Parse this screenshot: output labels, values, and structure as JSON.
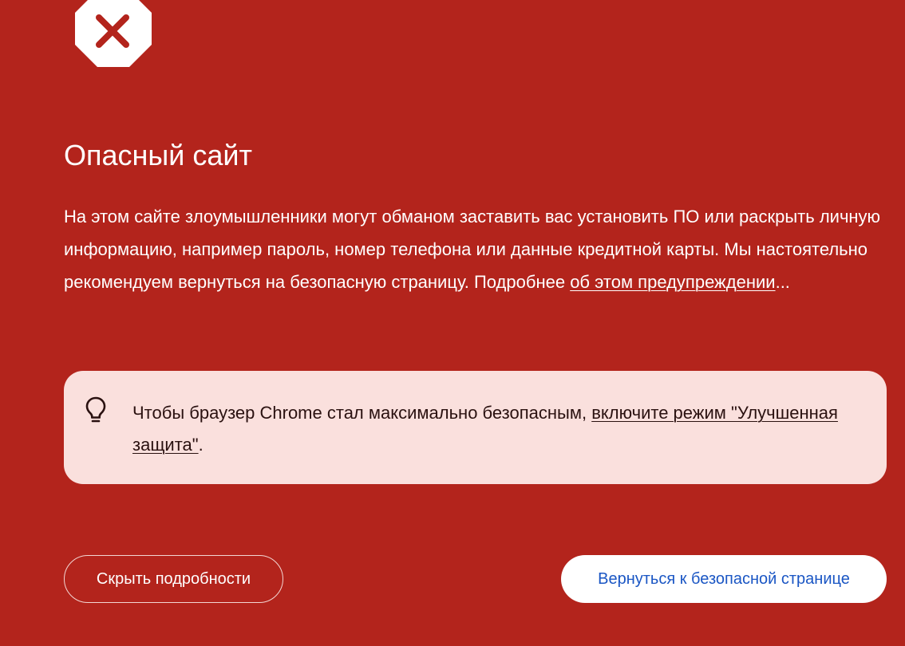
{
  "theme": {
    "background": "#b3241c",
    "tip_background": "#fae0dd",
    "back_button_text": "#1a56c4",
    "icon_x_color": "#b3241c"
  },
  "header": {
    "icon": "stop-octagon-x-icon",
    "title": "Опасный сайт"
  },
  "description": {
    "text": "На этом сайте злоумышленники могут обманом заставить вас установить ПО или раскрыть личную информацию, например пароль, номер телефона или данные кредитной карты. Мы настоятельно рекомендуем вернуться на безопасную страницу. Подробнее ",
    "link_label": "об этом предупреждении",
    "suffix": "..."
  },
  "tip": {
    "icon": "lightbulb-icon",
    "text": "Чтобы браузер Chrome стал максимально безопасным, ",
    "link_label": "включите режим \"Улучшенная защита\"",
    "suffix": "."
  },
  "buttons": {
    "details_label": "Скрыть подробности",
    "back_label": "Вернуться к безопасной странице"
  }
}
